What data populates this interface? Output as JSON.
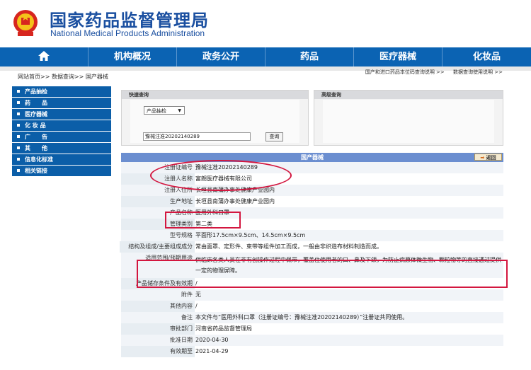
{
  "header": {
    "title_cn": "国家药品监督管理局",
    "title_en": "National Medical Products Administration",
    "emblem_icon": "national-emblem-icon"
  },
  "nav": {
    "home_icon": "home-icon",
    "items": [
      "机构概况",
      "政务公开",
      "药品",
      "医疗器械",
      "化妆品"
    ]
  },
  "breadcrumb": "网站首页>> 数据查询>> 国产器械",
  "top_links": [
    "国产和进口药品本位码查询说明 >>",
    "数据查询使用说明 >>"
  ],
  "sidebar": {
    "items": [
      "产品抽检",
      "药　　品",
      "医疗器械",
      "化 妆 品",
      "广　　告",
      "其　　他",
      "信息化标准",
      "相关链接"
    ]
  },
  "quick_search": {
    "title": "快速查询",
    "select_value": "产品抽检",
    "input_value": "豫械注准20202140289",
    "button_label": "查询"
  },
  "advanced_search": {
    "title": "高级查询"
  },
  "result": {
    "title": "国产器械",
    "back_label": "返回",
    "rows": [
      {
        "k": "注册证编号",
        "v": "豫械注准20202140289"
      },
      {
        "k": "注册人名称",
        "v": "富朗医疗器械有限公司"
      },
      {
        "k": "注册人住所",
        "v": "长垣县南蒲办事处健康产业园内"
      },
      {
        "k": "生产地址",
        "v": "长垣县南蒲办事处健康产业园内"
      },
      {
        "k": "产品名称",
        "v": "医用外科口罩"
      },
      {
        "k": "管理类别",
        "v": "第二类"
      },
      {
        "k": "型号规格",
        "v": "平面形17.5cm×9.5cm、14.5cm×9.5cm"
      },
      {
        "k": "结构及组成/主要组成成分",
        "v": "常由面罩、定形件、束带等组件加工而成，一般由非织造布材料制造而成。"
      },
      {
        "k": "适用范围/预期用途",
        "v": "供临床各类人员在非有创操作过程中佩带，覆盖住使用者的口、鼻及下颌，为防止病原体微生物、颗粒物等的直接透过提供一定的物理屏障。"
      },
      {
        "k": "产品储存条件及有效期",
        "v": "/"
      },
      {
        "k": "附件",
        "v": "无"
      },
      {
        "k": "其他内容",
        "v": "/"
      },
      {
        "k": "备注",
        "v": "本文件与“医用外科口罩（注册证编号：豫械注准20202140289）”注册证共同使用。"
      },
      {
        "k": "审批部门",
        "v": "河南省药品监督管理局"
      },
      {
        "k": "批准日期",
        "v": "2020-04-30"
      },
      {
        "k": "有效期至",
        "v": "2021-04-29"
      }
    ]
  },
  "colors": {
    "brand": "#1a4fa0",
    "nav": "#0b63b3",
    "table_head": "#6b8ed0",
    "annotation": "#d3163f"
  }
}
